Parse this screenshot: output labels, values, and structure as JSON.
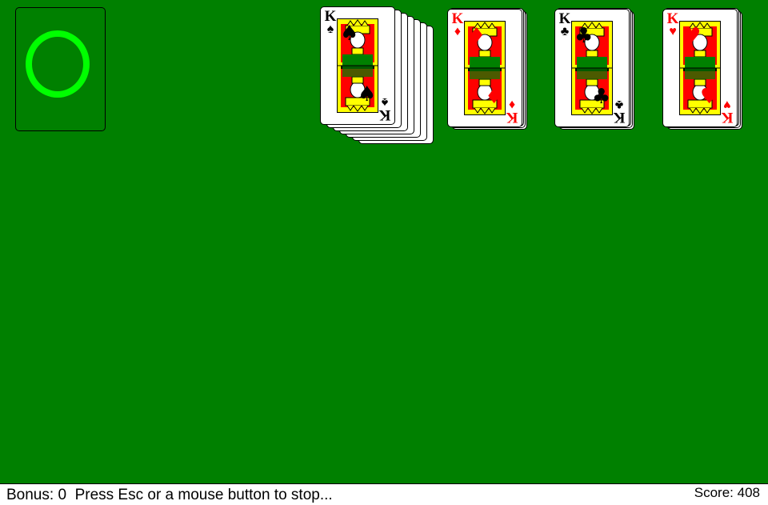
{
  "game": "Solitaire",
  "table_color": "#008000",
  "stock": {
    "state": "empty",
    "ring_color": "#00ff00",
    "icon": "recycle-ring-icon"
  },
  "foundations": [
    {
      "rank": "K",
      "suit": "♠",
      "suit_name": "spades",
      "color": "black",
      "style": "fanned"
    },
    {
      "rank": "K",
      "suit": "♦",
      "suit_name": "diamonds",
      "color": "red",
      "style": "stacked"
    },
    {
      "rank": "K",
      "suit": "♣",
      "suit_name": "clubs",
      "color": "black",
      "style": "stacked"
    },
    {
      "rank": "K",
      "suit": "♥",
      "suit_name": "hearts",
      "color": "red",
      "style": "stacked"
    }
  ],
  "status": {
    "bonus_label": "Bonus:",
    "bonus_value": "0",
    "message": "Press Esc or a mouse button to stop...",
    "score_label": "Score:",
    "score_value": "408"
  }
}
